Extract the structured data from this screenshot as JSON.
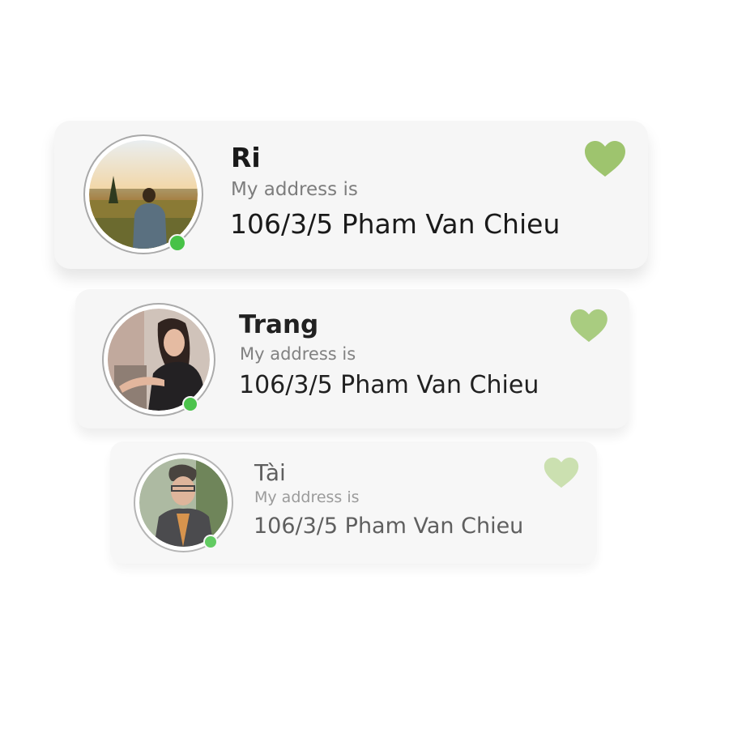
{
  "contacts": [
    {
      "name": "Ri",
      "address_label": "My address is",
      "address": "106/3/5 Pham Van Chieu",
      "online": true,
      "favorite_icon": "heart-icon",
      "favorite_color": "#9ec46e"
    },
    {
      "name": "Trang",
      "address_label": "My address is",
      "address": "106/3/5 Pham Van Chieu",
      "online": true,
      "favorite_icon": "heart-icon",
      "favorite_color": "#a7cb7c"
    },
    {
      "name": "Tài",
      "address_label": "My address is",
      "address": "106/3/5 Pham Van Chieu",
      "online": true,
      "favorite_icon": "heart-icon",
      "favorite_color": "#c2dba3"
    }
  ],
  "colors": {
    "card_background": "#f6f6f6",
    "online_status": "#47c247",
    "avatar_ring": "#a9a9a9"
  }
}
